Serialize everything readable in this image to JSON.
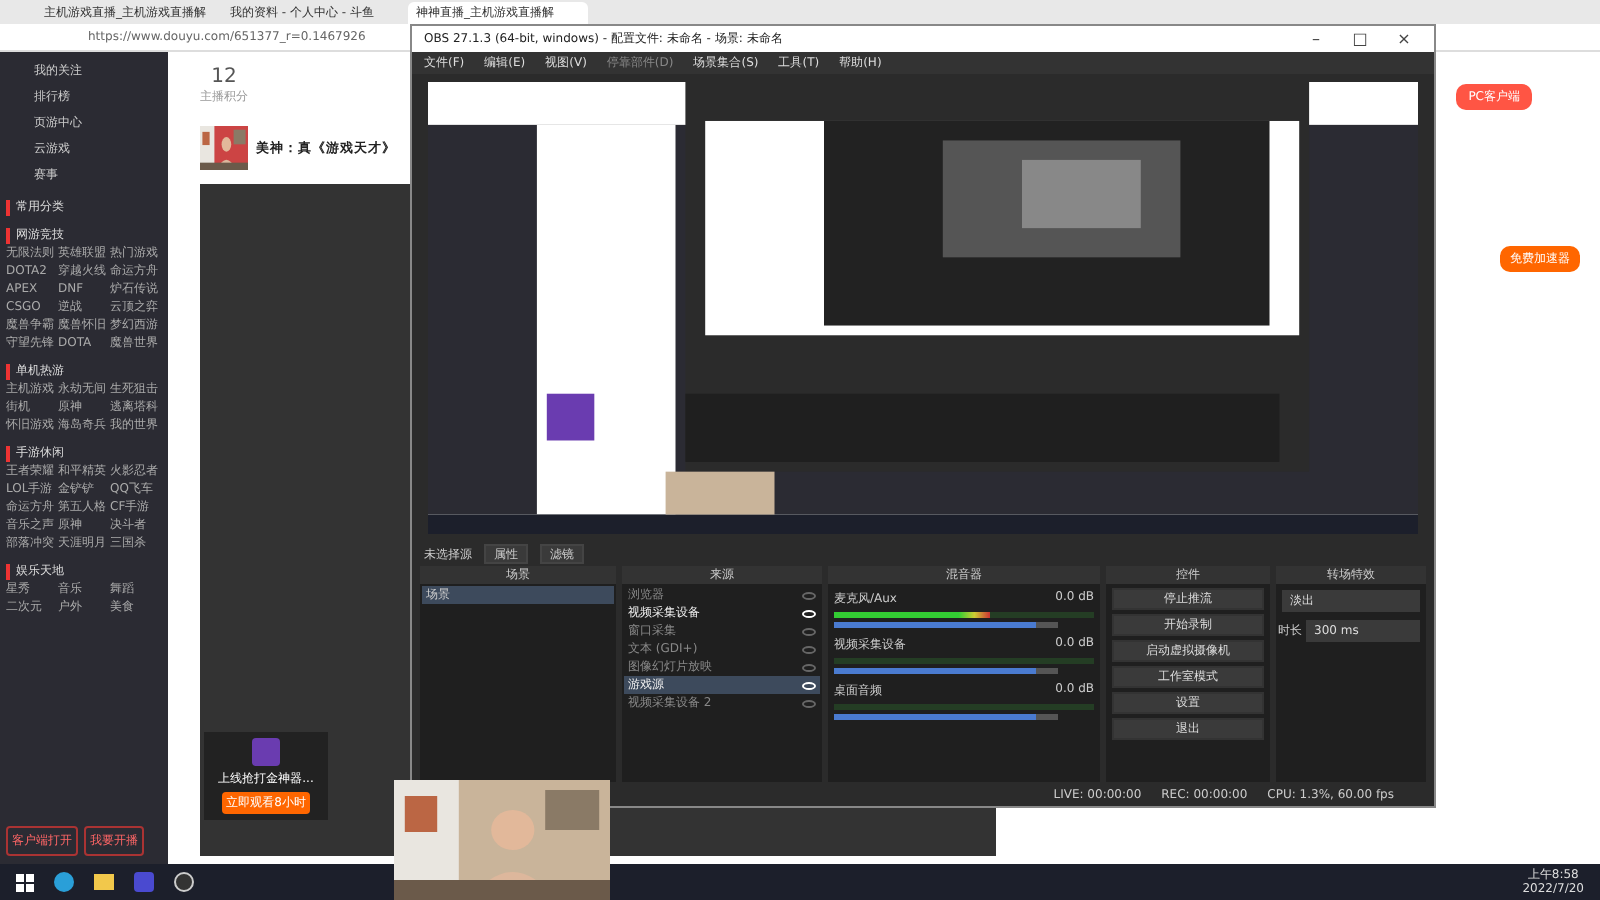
{
  "browser": {
    "tabs": [
      {
        "label": "主机游戏直播_主机游戏直播解",
        "selected": false
      },
      {
        "label": "我的资料 - 个人中心 - 斗鱼",
        "selected": false
      },
      {
        "label": "神神直播_主机游戏直播解",
        "selected": true
      }
    ],
    "url": "https://www.douyu.com/651377_r=0.1467926"
  },
  "site": {
    "nav": [
      "我的关注",
      "排行榜",
      "页游中心",
      "云游戏",
      "赛事"
    ],
    "sections": [
      {
        "title": "常用分类"
      },
      {
        "title": "网游竞技",
        "items": [
          "无限法则",
          "英雄联盟",
          "热门游戏",
          "DOTA2",
          "穿越火线",
          "命运方舟",
          "APEX",
          "DNF",
          "炉石传说",
          "CSGO",
          "逆战",
          "云顶之弈",
          "魔兽争霸",
          "魔兽怀旧",
          "梦幻西游",
          "守望先锋",
          "DOTA",
          "魔兽世界"
        ]
      },
      {
        "title": "单机热游",
        "items": [
          "主机游戏",
          "永劫无间",
          "生死狙击",
          "街机",
          "原神",
          "逃离塔科",
          "怀旧游戏",
          "海岛奇兵",
          "我的世界"
        ]
      },
      {
        "title": "手游休闲",
        "items": [
          "王者荣耀",
          "和平精英",
          "火影忍者",
          "LOL手游",
          "金铲铲",
          "QQ飞车",
          "命运方舟",
          "第五人格",
          "CF手游",
          "音乐之声",
          "原神",
          "决斗者",
          "部落冲突",
          "天涯明月",
          "三国杀"
        ]
      },
      {
        "title": "娱乐天地",
        "items": [
          "星秀",
          "音乐",
          "舞蹈",
          "二次元",
          "户外",
          "美食"
        ]
      }
    ],
    "client_button": "客户端打开",
    "record_button": "我要开播",
    "score": "12",
    "score_label": "主播积分",
    "streamer": "美神：真《游戏天才》",
    "ad_title": "上线抢打金神器...",
    "ad_button": "立即观看8小时",
    "pc_client": "PC客户端",
    "boost": "免费加速器"
  },
  "obs": {
    "title": "OBS 27.1.3 (64-bit, windows) - 配置文件: 未命名 - 场景: 未命名",
    "window_controls": [
      "–",
      "□",
      "×"
    ],
    "menu": [
      {
        "label": "文件(F)",
        "disabled": false
      },
      {
        "label": "编辑(E)",
        "disabled": false
      },
      {
        "label": "视图(V)",
        "disabled": false
      },
      {
        "label": "停靠部件(D)",
        "disabled": true
      },
      {
        "label": "场景集合(S)",
        "disabled": false
      },
      {
        "label": "工具(T)",
        "disabled": false
      },
      {
        "label": "帮助(H)",
        "disabled": false
      }
    ],
    "no_source": "未选择源",
    "properties": "属性",
    "filters": "滤镜",
    "docks": [
      "场景",
      "来源",
      "混音器",
      "控件",
      "转场特效"
    ],
    "scenes": [
      {
        "name": "场景",
        "selected": true
      }
    ],
    "sources": [
      {
        "name": "浏览器",
        "visible": false,
        "selected": false
      },
      {
        "name": "视频采集设备",
        "visible": true,
        "selected": false
      },
      {
        "name": "窗口采集",
        "visible": false,
        "selected": false
      },
      {
        "name": "文本 (GDI+)",
        "visible": false,
        "selected": false
      },
      {
        "name": "图像幻灯片放映",
        "visible": false,
        "selected": false
      },
      {
        "name": "游戏源",
        "visible": true,
        "selected": true
      },
      {
        "name": "视频采集设备 2",
        "visible": false,
        "selected": false
      }
    ],
    "mixer": [
      {
        "name": "麦克风/Aux",
        "reading": "0.0 dB",
        "level": 0.6,
        "fader": {
          "level": 0.9
        }
      },
      {
        "name": "视频采集设备",
        "reading": "0.0 dB",
        "fader": {
          "level": 0.9
        }
      },
      {
        "name": "桌面音频",
        "reading": "0.0 dB",
        "fader": {
          "level": 0.9
        }
      }
    ],
    "controls": [
      "停止推流",
      "开始录制",
      "启动虚拟摄像机",
      "工作室模式",
      "设置",
      "退出"
    ],
    "transition": "淡出",
    "duration_label": "时长",
    "duration": "300 ms",
    "status": [
      "LIVE: 00:00:00",
      "REC: 00:00:00",
      "CPU: 1.3%, 60.00 fps"
    ]
  },
  "taskbar": {
    "time": "上午8:58",
    "date": "2022/7/20"
  }
}
